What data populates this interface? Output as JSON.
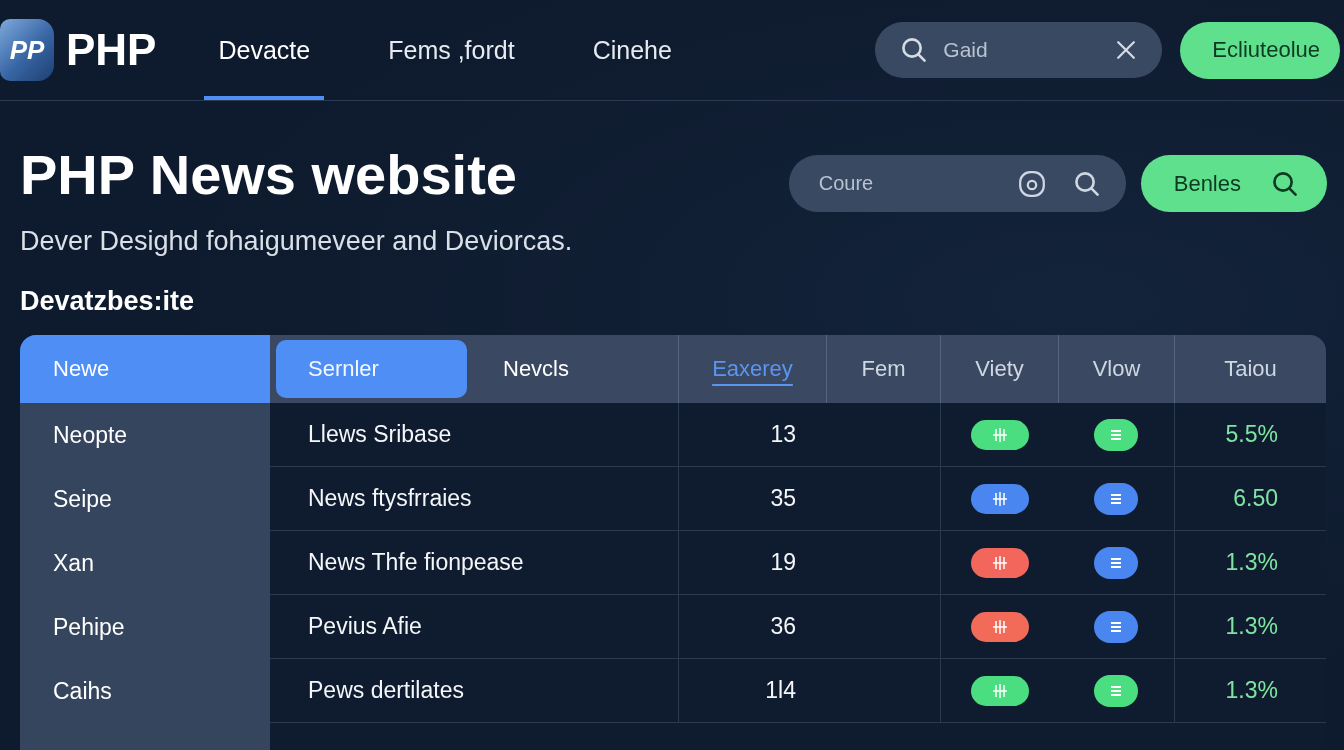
{
  "brand": {
    "logo_text": "PP",
    "name": "PHP"
  },
  "nav": [
    {
      "label": "Devacte",
      "selected": true
    },
    {
      "label": "Fems ,fordt",
      "selected": false
    },
    {
      "label": "Cinehe",
      "selected": false
    }
  ],
  "header_search": {
    "placeholder": "Gaid"
  },
  "header_button": "Ecliuteolue",
  "hero": {
    "title": "PHP News website",
    "subtitle": "Dever Desighd fohaigumeveer and Deviorcas.",
    "section_heading": "Devatzbes:ite"
  },
  "filter_search": {
    "placeholder": "Coure"
  },
  "filter_button": "Benles",
  "table": {
    "side_header": "Newe",
    "tabs": [
      {
        "label": "Sernler",
        "selected": true
      },
      {
        "label": "Nevcls",
        "selected": false
      }
    ],
    "columns": [
      {
        "label": "Eaxerey",
        "selected": true
      },
      {
        "label": "Fem",
        "selected": false
      },
      {
        "label": "Viety",
        "selected": false
      },
      {
        "label": "Vlow",
        "selected": false
      },
      {
        "label": "Taiou",
        "selected": false
      }
    ],
    "rows": [
      {
        "name": "Neopte",
        "title": "Llews Sribase",
        "count": "13",
        "tag": {
          "color": "#4ade80"
        },
        "dot": {
          "color": "#4ade80"
        },
        "rate": "5.5%"
      },
      {
        "name": "Seipe",
        "title": "News ftysfrraies",
        "count": "35",
        "tag": {
          "color": "#4a86f0"
        },
        "dot": {
          "color": "#4a86f0"
        },
        "rate": "6.50"
      },
      {
        "name": "Xan",
        "title": "News Thfe fionpease",
        "count": "19",
        "tag": {
          "color": "#f2665c"
        },
        "dot": {
          "color": "#4a86f0"
        },
        "rate": "1.3%"
      },
      {
        "name": "Pehipe",
        "title": "Pevius Afie",
        "count": "36",
        "tag": {
          "color": "#f26a58"
        },
        "dot": {
          "color": "#4a86f0"
        },
        "rate": "1.3%"
      },
      {
        "name": "Caihs",
        "title": "Pews dertilates",
        "count": "1l4",
        "tag": {
          "color": "#4ade80"
        },
        "dot": {
          "color": "#4ade80"
        },
        "rate": "1.3%"
      }
    ]
  }
}
